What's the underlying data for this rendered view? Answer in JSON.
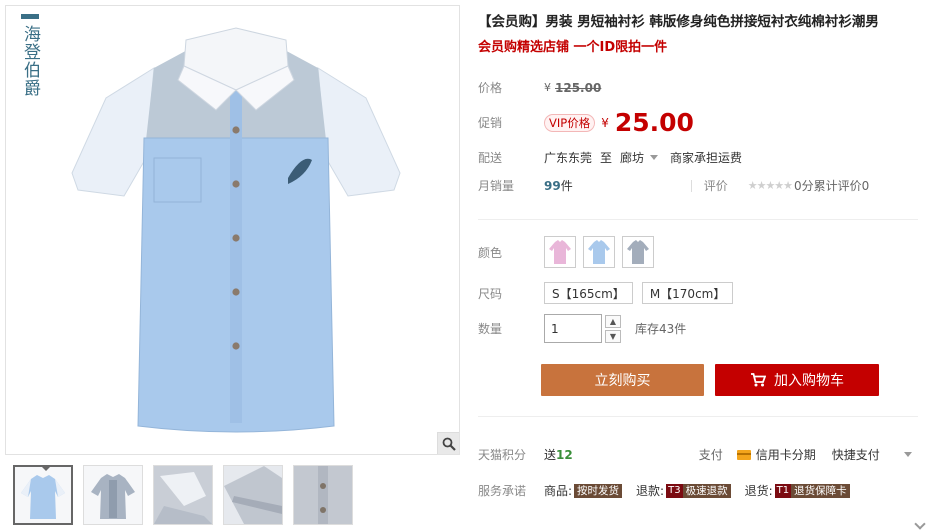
{
  "brand": {
    "name": "海登伯爵"
  },
  "product": {
    "title": "【会员购】男装 男短袖衬衫 韩版修身纯色拼接短衬衣纯棉衬衫潮男",
    "subtitle": "会员购精选店铺 一个ID限拍一件"
  },
  "price": {
    "label": "价格",
    "currency": "¥",
    "original": "125.00"
  },
  "promo": {
    "label": "促销",
    "badge": "VIP价格",
    "currency": "¥",
    "price": "25.00"
  },
  "shipping": {
    "label": "配送",
    "from": "广东东莞",
    "to_word": "至",
    "destination": "廊坊",
    "fee": "商家承担运费"
  },
  "sales": {
    "label": "月销量",
    "count": "99",
    "unit": "件",
    "rating_label": "评价",
    "rating_text": "0分累计评价0"
  },
  "color": {
    "label": "颜色",
    "options": [
      "pink",
      "light-blue",
      "grey"
    ]
  },
  "size": {
    "label": "尺码",
    "options": [
      "S【165cm】",
      "M【170cm】"
    ]
  },
  "quantity": {
    "label": "数量",
    "value": "1",
    "stock": "库存43件"
  },
  "actions": {
    "buy_now": "立刻购买",
    "add_to_cart": "加入购物车"
  },
  "points": {
    "label": "天猫积分",
    "send_word": "送",
    "value": "12",
    "pay_label": "支付",
    "credit_card": "信用卡分期",
    "quick_pay": "快捷支付"
  },
  "service": {
    "label": "服务承诺",
    "items": [
      {
        "prefix": "商品:",
        "key": "",
        "value": "按时发货"
      },
      {
        "prefix": "退款:",
        "key": "T3",
        "value": "极速退款"
      },
      {
        "prefix": "退货:",
        "key": "T1",
        "value": "退货保障卡"
      }
    ]
  },
  "colors": {
    "accent_red": "#c40000",
    "buy_button": "#c8733d",
    "brand_blue": "#3a6f86",
    "shirt_blue": "#a9c9ec"
  }
}
